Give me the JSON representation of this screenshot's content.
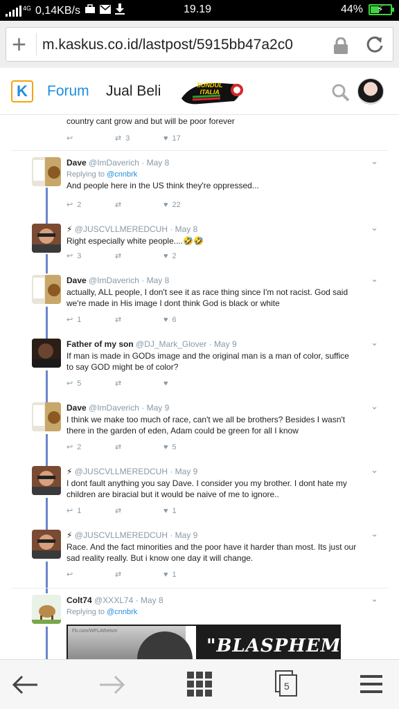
{
  "status_bar": {
    "network": "4G",
    "speed": "0,14KB/s",
    "time": "19.19",
    "battery": "44%",
    "battery_level": 0.44
  },
  "browser": {
    "url": "m.kaskus.co.id/lastpost/5915bb47a2c0",
    "tab_count": "5"
  },
  "site": {
    "logo": "K",
    "nav": {
      "forum": "Forum",
      "jual_beli": "Jual Beli"
    },
    "banner_text": "SUNDUL ITALIA"
  },
  "tweets": [
    {
      "text": "country cant grow and but will be poor forever",
      "retweets": "3",
      "likes": "17"
    },
    {
      "name": "Dave",
      "handle": "@ImDaverich",
      "date": "May 8",
      "replying_label": "Replying to",
      "replying_to": "@cnnbrk",
      "text": "And people here in the US think they're oppressed...",
      "replies": "2",
      "retweets": "",
      "likes": "22"
    },
    {
      "name": "⚡",
      "handle": "@JUSCVLLMEREDCUH",
      "date": "May 8",
      "text": "Right especially white people....🤣🤣",
      "replies": "3",
      "retweets": "",
      "likes": "2"
    },
    {
      "name": "Dave",
      "handle": "@ImDaverich",
      "date": "May 8",
      "text": "actually, ALL people, I don't see it as race thing since I'm not racist. God said we're made in His image I dont think God is black or white",
      "replies": "1",
      "retweets": "",
      "likes": "6"
    },
    {
      "name": "Father of my son",
      "handle": "@DJ_Mark_Glover",
      "date": "May 9",
      "text": "If man is made in GODs image and the original man is a man of color, suffice to say GOD might be of color?",
      "replies": "5",
      "retweets": "",
      "likes": ""
    },
    {
      "name": "Dave",
      "handle": "@ImDaverich",
      "date": "May 9",
      "text": "I think we make too much of race, can't we all be brothers? Besides I wasn't there in the garden of eden, Adam could be green for all I know",
      "replies": "2",
      "retweets": "",
      "likes": "5"
    },
    {
      "name": "⚡",
      "handle": "@JUSCVLLMEREDCUH",
      "date": "May 9",
      "text": "I dont fault anything you say Dave. I consider you my brother. I dont hate my children are biracial but it would be naive of me to ignore..",
      "replies": "1",
      "retweets": "",
      "likes": "1"
    },
    {
      "name": "⚡",
      "handle": "@JUSCVLLMEREDCUH",
      "date": "May 9",
      "text": "Race. And the fact minorities and the poor have it harder than most. Its just our sad reality really. But i know one day it will change.",
      "replies": "",
      "retweets": "",
      "likes": "1"
    },
    {
      "name": "Colt74",
      "handle": "@XXXL74",
      "date": "May 8",
      "replying_label": "Replying to",
      "replying_to": "@cnnbrk",
      "image_text": "\"BLASPHEMY:",
      "image_caption": "Fb.com/WFLAtheism"
    }
  ],
  "colors": {
    "accent": "#1f8ee0",
    "thread_line": "#6b87c9",
    "muted": "#8899a6",
    "battery": "#3fd53f"
  }
}
